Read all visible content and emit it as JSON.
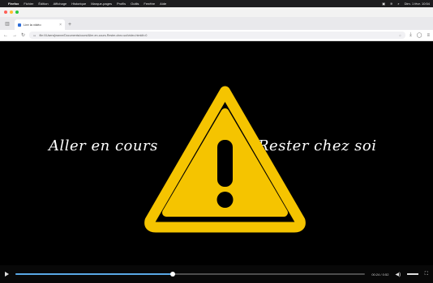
{
  "menubar": {
    "app": "Firefox",
    "items": [
      "Fichier",
      "Édition",
      "Affichage",
      "Historique",
      "Marque-pages",
      "Profils",
      "Outils",
      "Fenêtre",
      "Aide"
    ],
    "clock": "Dim. 1 févr. 10:54"
  },
  "tab": {
    "title": "Lire la vidéo"
  },
  "address": {
    "url": "file:///Users/jeanne/Documents/cours/Aller-en-cours-Rester-chez-soi/video.html#t=0"
  },
  "video": {
    "caption_left": "Aller en cours",
    "caption_right": "Rester chez soi",
    "progress": 0.45,
    "time": "00:24 / 0:52",
    "colors": {
      "warning_yellow": "#f5c400",
      "background": "#000000",
      "progress": "#5aa9e6"
    }
  },
  "icons": {
    "sidebar": "sidebar-icon",
    "back": "back-arrow-icon",
    "forward": "forward-arrow-icon",
    "reload": "reload-icon",
    "page": "page-icon",
    "bookmark": "star-icon",
    "downloads": "download-icon",
    "account": "account-icon",
    "menu": "hamburger-menu-icon",
    "warning": "warning-triangle-icon"
  }
}
